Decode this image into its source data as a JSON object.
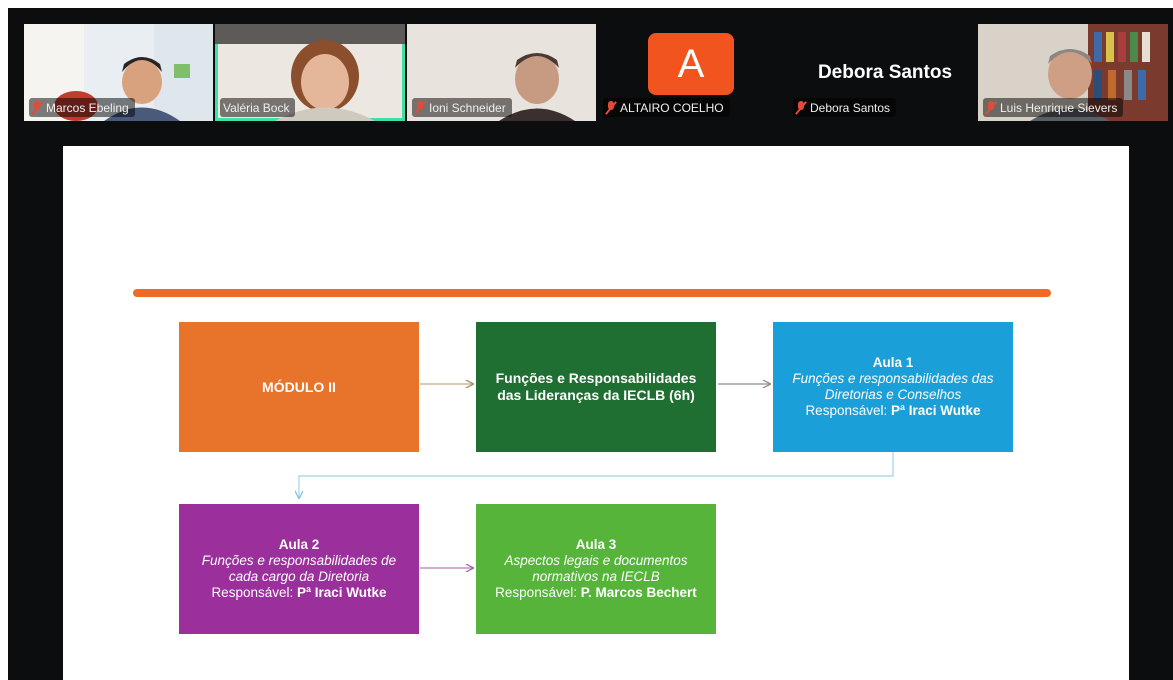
{
  "participants": [
    {
      "name": "Marcos Ebeling",
      "muted": true
    },
    {
      "name": "Valéria Bock",
      "muted": false,
      "speaking": true
    },
    {
      "name": "Ioni Schneider",
      "muted": true
    },
    {
      "name": "ALTAIRO COELHO",
      "muted": true,
      "avatar_letter": "A"
    },
    {
      "name": "Debora Santos",
      "muted": true,
      "display_name": "Debora Santos"
    },
    {
      "name": "Luis Henrique Sievers",
      "muted": true
    }
  ],
  "colors": {
    "orange": "#e8742b",
    "dark_green": "#1f6e32",
    "blue": "#1a9fd8",
    "purple": "#9b2f9c",
    "green": "#56b43a",
    "speaker_outline": "#3ee0a4"
  },
  "slide": {
    "modulo": {
      "title": "MÓDULO II"
    },
    "funcoes": {
      "title": "Funções e Responsabilidades das Lideranças da IECLB (6h)"
    },
    "aula1": {
      "title": "Aula 1",
      "subtitle": "Funções e responsabilidades das Diretorias e Conselhos",
      "resp_label": "Responsável:",
      "resp_name": "Pª Iraci Wutke"
    },
    "aula2": {
      "title": "Aula 2",
      "subtitle": "Funções e responsabilidades de cada cargo da Diretoria",
      "resp_label": "Responsável:",
      "resp_name": "Pª Iraci Wutke"
    },
    "aula3": {
      "title": "Aula 3",
      "subtitle": "Aspectos legais e documentos normativos na IECLB",
      "resp_label": "Responsável:",
      "resp_name": "P. Marcos Bechert"
    }
  }
}
